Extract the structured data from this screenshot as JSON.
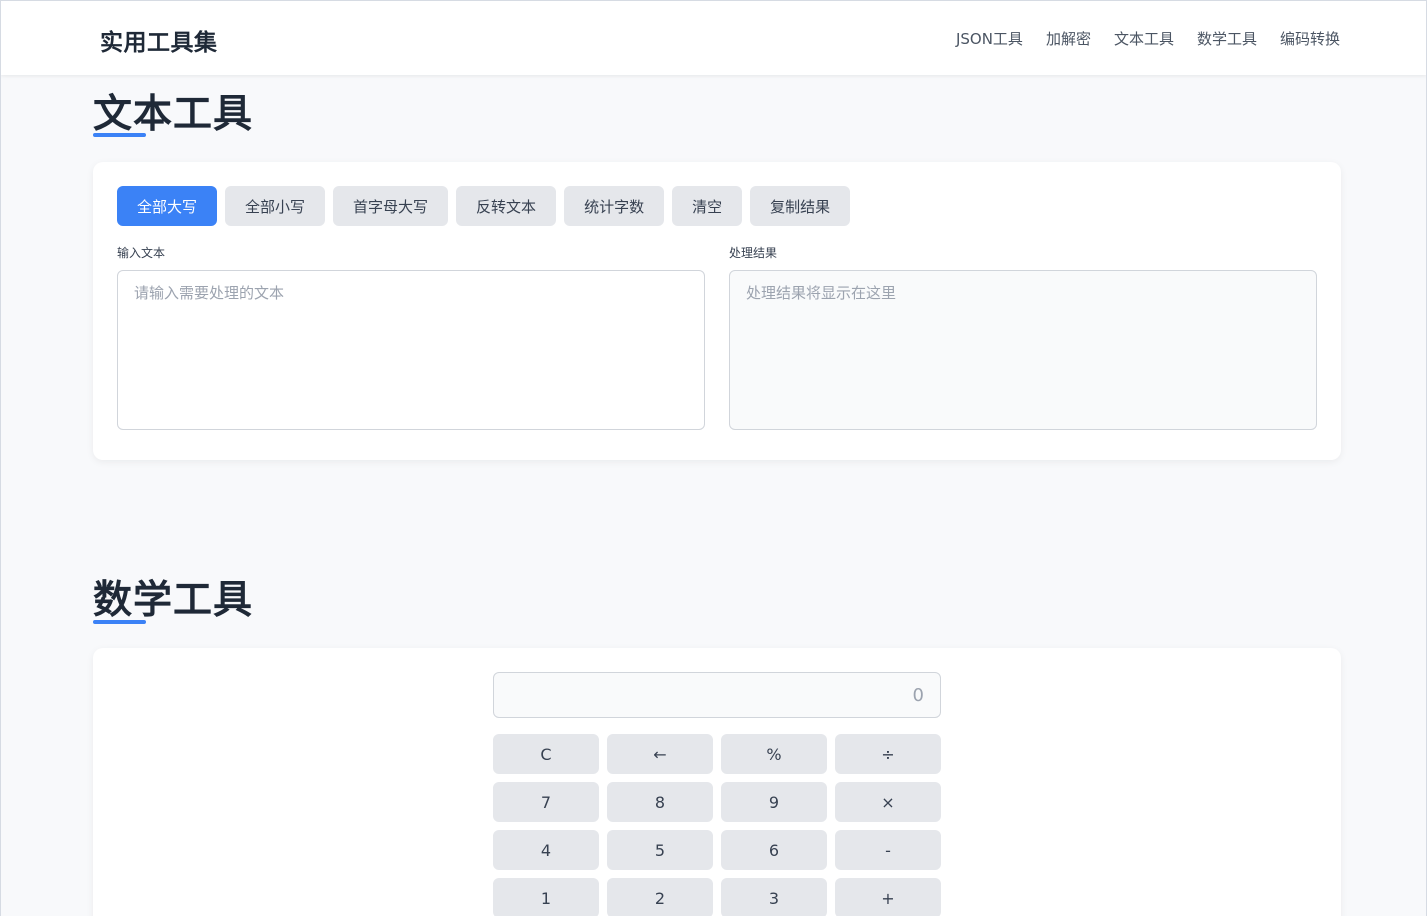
{
  "header": {
    "brand": "实用工具集",
    "nav": [
      "JSON工具",
      "加解密",
      "文本工具",
      "数学工具",
      "编码转换"
    ]
  },
  "text_tools": {
    "title": "文本工具",
    "buttons": [
      "全部大写",
      "全部小写",
      "首字母大写",
      "反转文本",
      "统计字数",
      "清空",
      "复制结果"
    ],
    "input_label": "输入文本",
    "input_placeholder": "请输入需要处理的文本",
    "output_label": "处理结果",
    "output_placeholder": "处理结果将显示在这里"
  },
  "math_tools": {
    "title": "数学工具",
    "display_value": "0",
    "keys": [
      "C",
      "←",
      "%",
      "÷",
      "7",
      "8",
      "9",
      "×",
      "4",
      "5",
      "6",
      "-",
      "1",
      "2",
      "3",
      "+"
    ]
  },
  "colors": {
    "accent": "#3b82f6",
    "background": "#f8f9fb",
    "button_bg": "#e5e7eb"
  }
}
